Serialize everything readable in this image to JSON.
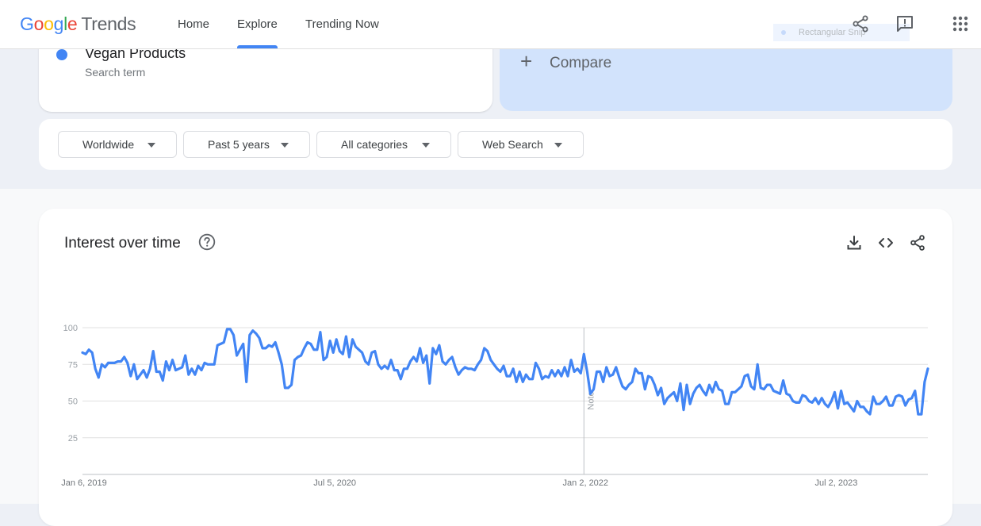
{
  "header": {
    "logo_google": "Google",
    "logo_trends": "Trends",
    "nav": [
      {
        "label": "Home",
        "active": false
      },
      {
        "label": "Explore",
        "active": true
      },
      {
        "label": "Trending Now",
        "active": false
      }
    ],
    "ghost_tooltip": "Rectangular Snip",
    "icons": [
      "share-icon",
      "feedback-icon",
      "apps-icon"
    ]
  },
  "search_term": {
    "name": "Vegan Products",
    "type_label": "Search term",
    "color": "#4285f4"
  },
  "compare": {
    "label": "Compare"
  },
  "filters": [
    {
      "label": "Worldwide"
    },
    {
      "label": "Past 5 years"
    },
    {
      "label": "All categories"
    },
    {
      "label": "Web Search"
    }
  ],
  "chart_card": {
    "title": "Interest over time",
    "icons": [
      "help-icon",
      "download-icon",
      "embed-icon",
      "share-icon"
    ]
  },
  "chart_data": {
    "type": "line",
    "title": "Interest over time",
    "xlabel": "",
    "ylabel": "",
    "ylim": [
      0,
      100
    ],
    "yticks": [
      25,
      50,
      75,
      100
    ],
    "xticks": [
      "Jan 6, 2019",
      "Jul 5, 2020",
      "Jan 2, 2022",
      "Jul 2, 2023"
    ],
    "xtick_positions": [
      0,
      78,
      156,
      234
    ],
    "annotation": {
      "label": "Note",
      "week_index": 156
    },
    "grid": true,
    "legend": "none",
    "series": [
      {
        "name": "Vegan Products",
        "color": "#4285f4",
        "values": [
          83,
          82,
          85,
          83,
          72,
          66,
          75,
          73,
          76,
          76,
          76,
          77,
          77,
          80,
          76,
          67,
          75,
          65,
          68,
          71,
          66,
          72,
          84,
          70,
          70,
          64,
          77,
          71,
          78,
          71,
          72,
          73,
          81,
          68,
          72,
          68,
          74,
          71,
          76,
          75,
          75,
          75,
          88,
          89,
          90,
          99,
          99,
          95,
          81,
          85,
          89,
          63,
          95,
          98,
          96,
          93,
          86,
          86,
          88,
          87,
          90,
          83,
          75,
          59,
          59,
          61,
          78,
          80,
          81,
          86,
          90,
          89,
          85,
          85,
          97,
          78,
          80,
          91,
          83,
          92,
          84,
          82,
          94,
          80,
          92,
          87,
          85,
          83,
          77,
          75,
          83,
          84,
          75,
          72,
          74,
          72,
          78,
          71,
          71,
          65,
          72,
          72,
          77,
          80,
          77,
          86,
          76,
          81,
          62,
          86,
          82,
          88,
          77,
          75,
          78,
          80,
          73,
          68,
          71,
          73,
          72,
          72,
          71,
          75,
          78,
          86,
          84,
          78,
          75,
          72,
          70,
          74,
          67,
          67,
          72,
          63,
          70,
          63,
          68,
          65,
          65,
          76,
          72,
          65,
          67,
          66,
          71,
          67,
          71,
          67,
          73,
          67,
          78,
          70,
          72,
          69,
          82,
          70,
          55,
          58,
          70,
          70,
          63,
          73,
          67,
          68,
          73,
          66,
          60,
          58,
          61,
          63,
          72,
          69,
          69,
          58,
          67,
          66,
          61,
          54,
          59,
          48,
          52,
          54,
          56,
          50,
          62,
          44,
          61,
          48,
          55,
          59,
          61,
          57,
          54,
          61,
          56,
          63,
          58,
          57,
          48,
          48,
          56,
          56,
          58,
          60,
          67,
          68,
          60,
          58,
          75,
          59,
          58,
          61,
          61,
          57,
          56,
          55,
          64,
          55,
          54,
          50,
          49,
          49,
          54,
          53,
          50,
          49,
          52,
          48,
          52,
          48,
          46,
          50,
          56,
          45,
          57,
          48,
          49,
          46,
          43,
          50,
          46,
          46,
          43,
          41,
          53,
          48,
          48,
          50,
          53,
          47,
          47,
          53,
          54,
          53,
          47,
          51,
          52,
          57,
          41,
          41,
          63,
          72
        ]
      }
    ]
  }
}
